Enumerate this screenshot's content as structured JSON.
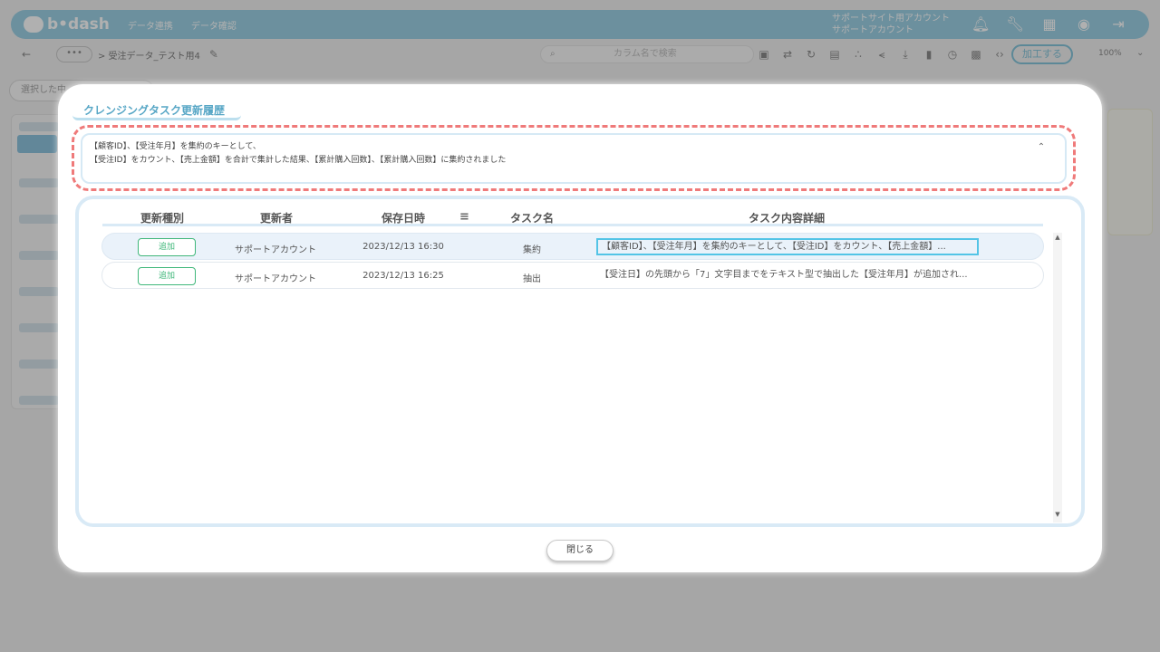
{
  "app": {
    "logo_text": "b•dash",
    "nav": [
      "データ連携",
      "データ確認"
    ],
    "account_line1": "サポートサイト用アカウント",
    "account_line2": "サポートアカウント",
    "toolbar": {
      "dots": "•••",
      "breadcrumb": "> 受注データ_テスト用4",
      "search_placeholder": "カラム名で検索",
      "process_button": "加工する",
      "zoom": "100%"
    },
    "select_placeholder": "選択した中"
  },
  "modal": {
    "title": "クレンジングタスク更新履歴",
    "summary_line1": "【顧客ID】、【受注年月】を集約のキーとして、",
    "summary_line2": "【受注ID】をカウント、【売上金額】を合計で集計した結果、【累計購入回数】、【累計購入回数】に集約されました",
    "columns": {
      "type": "更新種別",
      "updater": "更新者",
      "saved_at": "保存日時",
      "task_name": "タスク名",
      "detail": "タスク内容詳細"
    },
    "rows": [
      {
        "type": "追加",
        "updater": "サポートアカウント",
        "saved_at": "2023/12/13 16:30",
        "task_name": "集約",
        "detail": "【顧客ID】、【受注年月】を集約のキーとして、【受注ID】をカウント、【売上金額】..."
      },
      {
        "type": "追加",
        "updater": "サポートアカウント",
        "saved_at": "2023/12/13 16:25",
        "task_name": "抽出",
        "detail": "【受注日】の先頭から「7」文字目までをテキスト型で抽出した【受注年月】が追加され..."
      }
    ],
    "close_label": "閉じる"
  },
  "colors": {
    "brand": "#7dc2dc",
    "accent": "#58a7c6",
    "badge": "#3fb77a",
    "highlight": "#ef7a7a"
  }
}
